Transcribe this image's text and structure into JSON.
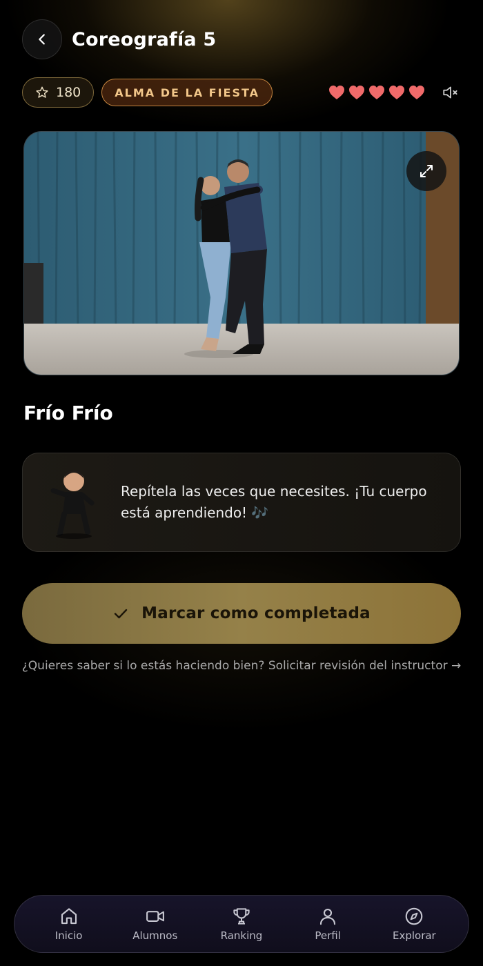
{
  "header": {
    "title": "Coreografía 5",
    "back_icon": "chevron-left-icon"
  },
  "stats": {
    "points": "180",
    "points_icon": "star-outline-icon",
    "level_badge": "ALMA DE LA FIESTA",
    "hearts_filled": 5,
    "heart_color": "#f06a6a",
    "mute_icon": "volume-mute-icon"
  },
  "video": {
    "expand_icon": "expand-icon"
  },
  "song": {
    "title": "Frío Frío"
  },
  "tip": {
    "text": "Repítela las veces que necesites. ¡Tu cuerpo está aprendiendo! 🎶"
  },
  "actions": {
    "complete_label": "Marcar como completada",
    "review_link": "¿Quieres saber si lo estás haciendo bien? Solicitar revisión del instructor →"
  },
  "nav": {
    "items": [
      {
        "label": "Inicio",
        "icon": "home-icon"
      },
      {
        "label": "Alumnos",
        "icon": "video-camera-icon"
      },
      {
        "label": "Ranking",
        "icon": "trophy-icon"
      },
      {
        "label": "Perfil",
        "icon": "user-icon"
      },
      {
        "label": "Explorar",
        "icon": "compass-icon"
      }
    ]
  },
  "colors": {
    "accent_gold": "#958149",
    "level_border": "#c4843f",
    "background": "#000000"
  }
}
